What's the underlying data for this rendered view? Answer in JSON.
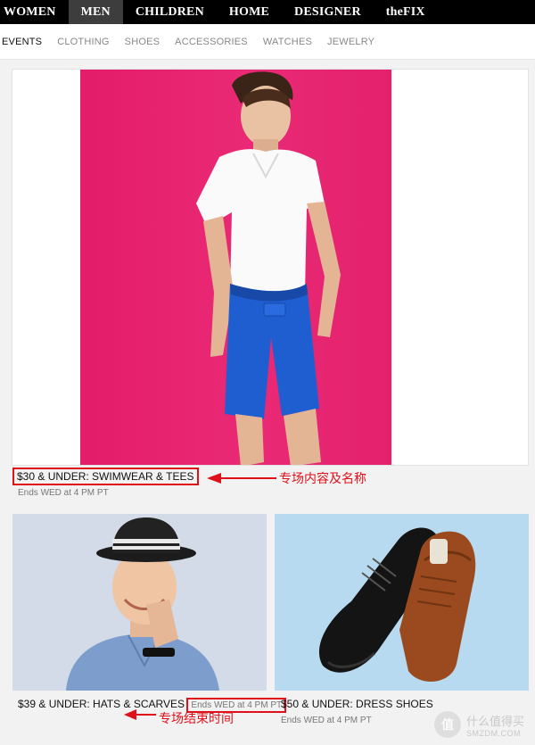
{
  "top_nav": {
    "items": [
      {
        "label": "WOMEN"
      },
      {
        "label": "MEN",
        "active": true
      },
      {
        "label": "CHILDREN"
      },
      {
        "label": "HOME"
      },
      {
        "label": "DESIGNER"
      },
      {
        "label": "theFIX"
      }
    ]
  },
  "sub_nav": {
    "items": [
      {
        "label": "EVENTS",
        "active": true
      },
      {
        "label": "CLOTHING"
      },
      {
        "label": "SHOES"
      },
      {
        "label": "ACCESSORIES"
      },
      {
        "label": "WATCHES"
      },
      {
        "label": "JEWELRY"
      }
    ]
  },
  "events": [
    {
      "title": "$30 & UNDER: SWIMWEAR & TEES",
      "ends": "Ends WED at 4 PM PT",
      "image": "man in white tee and blue shorts on pink background"
    },
    {
      "title": "$39 & UNDER: HATS & SCARVES",
      "ends": "Ends WED at 4 PM PT",
      "image": "smiling man in striped fedora and denim shirt"
    },
    {
      "title": "$50 & UNDER: DRESS SHOES",
      "ends": "Ends WED at 4 PM PT",
      "image": "black and brown leather dress shoes"
    }
  ],
  "annotations": {
    "event_name": "专场内容及名称",
    "end_time": "专场结束时间"
  },
  "watermark": {
    "glyph": "值",
    "cn": "什么值得买",
    "en": "SMZDM.COM"
  },
  "colors": {
    "nav_bg": "#000000",
    "nav_active_bg": "#3d3d3d",
    "hero_pink": "#e41c69",
    "shorts_blue": "#1f5ed1",
    "annotation_red": "#e0101a"
  }
}
